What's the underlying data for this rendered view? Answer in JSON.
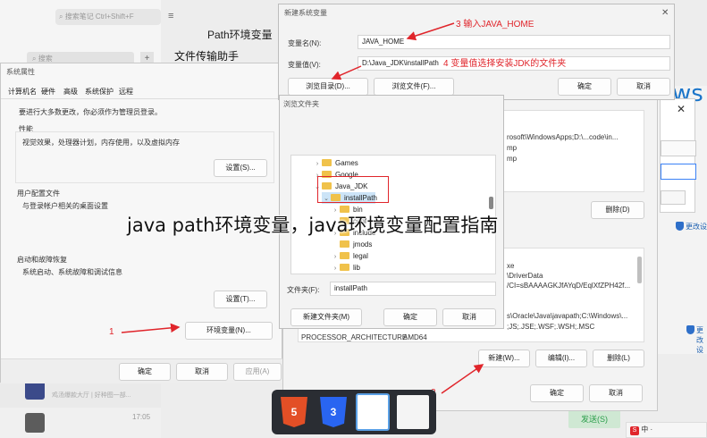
{
  "wechat": {
    "search_placeholder": "搜索笔记 Ctrl+Shift+F",
    "search2_placeholder": "搜索",
    "chat_title": "文件传输助手",
    "header_fragment": "Path环境变量",
    "item_time": "17:05",
    "send_button": "发送(S)",
    "item_preview": "鸡汤爆款大厅 | 好种图一部..."
  },
  "sysprops": {
    "title": "系统属性",
    "tabs": [
      "计算机名",
      "硬件",
      "高级",
      "系统保护",
      "远程"
    ],
    "admin_note": "要进行大多数更改，你必须作为管理员登录。",
    "perf_title": "性能",
    "perf_desc": "视觉效果，处理器计划，内存使用，以及虚拟内存",
    "perf_button": "设置(S)...",
    "profile_title": "用户配置文件",
    "profile_desc": "与登录帐户相关的桌面设置",
    "startup_title": "启动和故障恢复",
    "startup_desc": "系统启动、系统故障和调试信息",
    "startup_button": "设置(T)...",
    "env_button": "环境变量(N)...",
    "ok": "确定",
    "cancel": "取消",
    "apply": "应用(A)"
  },
  "newvar": {
    "title": "新建系统变量",
    "name_label": "变量名(N):",
    "name_value": "JAVA_HOME",
    "value_label": "变量值(V):",
    "value_value": "D:\\Java_JDK\\installPath",
    "browse_dir": "浏览目录(D)...",
    "browse_file": "浏览文件(F)...",
    "ok": "确定",
    "cancel": "取消"
  },
  "browse": {
    "title": "浏览文件夹",
    "tree": [
      "Games",
      "Google",
      "Java_JDK",
      "installPath",
      "bin",
      "conf",
      "include",
      "jmods",
      "legal",
      "lib"
    ],
    "folder_label": "文件夹(F):",
    "folder_value": "installPath",
    "new_folder": "新建文件夹(M)",
    "ok": "确定",
    "cancel": "取消"
  },
  "envvars": {
    "user_values": [
      "rosoft\\WindowsApps;D:\\...code\\in...",
      "mp",
      "mp"
    ],
    "user_buttons": [
      "删除(D)"
    ],
    "sys_values": [
      "xe",
      "\\DriverData",
      "/CI=sBAAAAGKJfAYqD/EqlXfZPH42f...",
      "",
      "s\\Oracle\\Java\\javapath;C:\\Windows\\...",
      "",
      ";JS;.JSE;.WSF;.WSH;.MSC"
    ],
    "sys_row_name": "PROCESSOR_ARCHITECTURE",
    "sys_row_value": "AMD64",
    "new_button": "新建(W)...",
    "edit_button": "编辑(I)...",
    "delete_button": "删除(L)",
    "ok": "确定",
    "cancel": "取消"
  },
  "right_panel": {
    "logo_text": "ws",
    "link1": "更改设",
    "link2": "更改设"
  },
  "annotations": {
    "step1": "1",
    "step2": "2",
    "step3": "3 输入JAVA_HOME",
    "step4": "4 变量值选择安装JDK的文件夹"
  },
  "overlay_title": "java path环境变量，java环境变量配置指南",
  "taskbar": {
    "icons": [
      "html5-icon",
      "css3-icon",
      "window-thumbnail",
      "window-thumbnail"
    ]
  }
}
